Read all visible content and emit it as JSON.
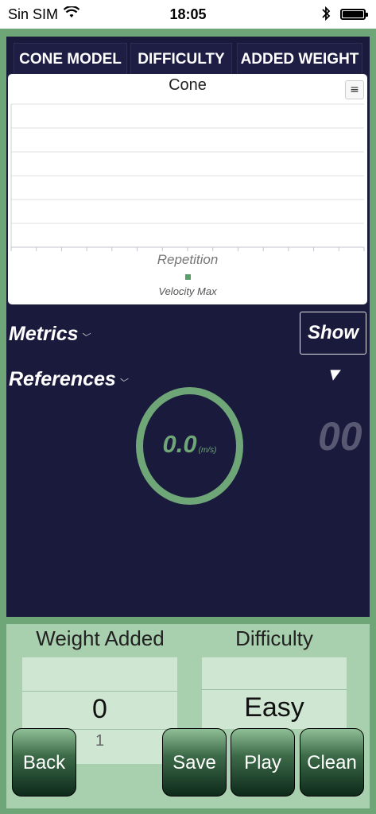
{
  "status_bar": {
    "carrier": "Sin SIM",
    "time": "18:05"
  },
  "tabs": [
    "CONE MODEL",
    "DIFFICULTY",
    "ADDED WEIGHT"
  ],
  "chart_data": {
    "type": "line",
    "title": "Cone",
    "xlabel": "Repetition",
    "ylabel": "",
    "series": [
      {
        "name": "Velocity Max",
        "values": []
      }
    ],
    "grid": true,
    "legend": "bottom"
  },
  "metrics_label": "Metrics",
  "references_label": "References",
  "show_label": "Show ▾",
  "gauge": {
    "value": "0.0",
    "unit": "(m/s)"
  },
  "counter": "00",
  "weight_added": {
    "label": "Weight Added",
    "value": "0",
    "next_value": "1"
  },
  "difficulty": {
    "label": "Difficulty",
    "value": "Easy"
  },
  "buttons": {
    "back": "Back",
    "save": "Save",
    "play": "Play",
    "clean": "Clean"
  },
  "colors": {
    "accent": "#6fa677",
    "panel": "#1a1a3d",
    "bottom_panel": "#a8cfae"
  }
}
